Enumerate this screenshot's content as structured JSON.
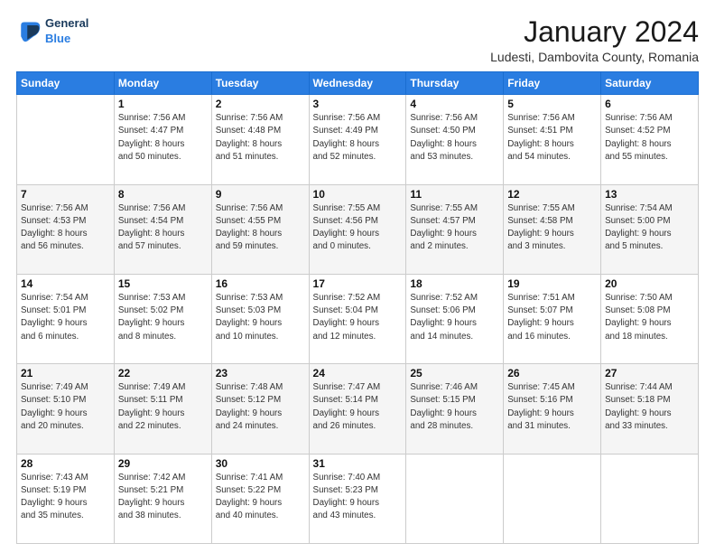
{
  "header": {
    "logo_line1": "General",
    "logo_line2": "Blue",
    "main_title": "January 2024",
    "subtitle": "Ludesti, Dambovita County, Romania"
  },
  "weekdays": [
    "Sunday",
    "Monday",
    "Tuesday",
    "Wednesday",
    "Thursday",
    "Friday",
    "Saturday"
  ],
  "weeks": [
    [
      {
        "day": "",
        "info": ""
      },
      {
        "day": "1",
        "info": "Sunrise: 7:56 AM\nSunset: 4:47 PM\nDaylight: 8 hours\nand 50 minutes."
      },
      {
        "day": "2",
        "info": "Sunrise: 7:56 AM\nSunset: 4:48 PM\nDaylight: 8 hours\nand 51 minutes."
      },
      {
        "day": "3",
        "info": "Sunrise: 7:56 AM\nSunset: 4:49 PM\nDaylight: 8 hours\nand 52 minutes."
      },
      {
        "day": "4",
        "info": "Sunrise: 7:56 AM\nSunset: 4:50 PM\nDaylight: 8 hours\nand 53 minutes."
      },
      {
        "day": "5",
        "info": "Sunrise: 7:56 AM\nSunset: 4:51 PM\nDaylight: 8 hours\nand 54 minutes."
      },
      {
        "day": "6",
        "info": "Sunrise: 7:56 AM\nSunset: 4:52 PM\nDaylight: 8 hours\nand 55 minutes."
      }
    ],
    [
      {
        "day": "7",
        "info": "Sunrise: 7:56 AM\nSunset: 4:53 PM\nDaylight: 8 hours\nand 56 minutes."
      },
      {
        "day": "8",
        "info": "Sunrise: 7:56 AM\nSunset: 4:54 PM\nDaylight: 8 hours\nand 57 minutes."
      },
      {
        "day": "9",
        "info": "Sunrise: 7:56 AM\nSunset: 4:55 PM\nDaylight: 8 hours\nand 59 minutes."
      },
      {
        "day": "10",
        "info": "Sunrise: 7:55 AM\nSunset: 4:56 PM\nDaylight: 9 hours\nand 0 minutes."
      },
      {
        "day": "11",
        "info": "Sunrise: 7:55 AM\nSunset: 4:57 PM\nDaylight: 9 hours\nand 2 minutes."
      },
      {
        "day": "12",
        "info": "Sunrise: 7:55 AM\nSunset: 4:58 PM\nDaylight: 9 hours\nand 3 minutes."
      },
      {
        "day": "13",
        "info": "Sunrise: 7:54 AM\nSunset: 5:00 PM\nDaylight: 9 hours\nand 5 minutes."
      }
    ],
    [
      {
        "day": "14",
        "info": "Sunrise: 7:54 AM\nSunset: 5:01 PM\nDaylight: 9 hours\nand 6 minutes."
      },
      {
        "day": "15",
        "info": "Sunrise: 7:53 AM\nSunset: 5:02 PM\nDaylight: 9 hours\nand 8 minutes."
      },
      {
        "day": "16",
        "info": "Sunrise: 7:53 AM\nSunset: 5:03 PM\nDaylight: 9 hours\nand 10 minutes."
      },
      {
        "day": "17",
        "info": "Sunrise: 7:52 AM\nSunset: 5:04 PM\nDaylight: 9 hours\nand 12 minutes."
      },
      {
        "day": "18",
        "info": "Sunrise: 7:52 AM\nSunset: 5:06 PM\nDaylight: 9 hours\nand 14 minutes."
      },
      {
        "day": "19",
        "info": "Sunrise: 7:51 AM\nSunset: 5:07 PM\nDaylight: 9 hours\nand 16 minutes."
      },
      {
        "day": "20",
        "info": "Sunrise: 7:50 AM\nSunset: 5:08 PM\nDaylight: 9 hours\nand 18 minutes."
      }
    ],
    [
      {
        "day": "21",
        "info": "Sunrise: 7:49 AM\nSunset: 5:10 PM\nDaylight: 9 hours\nand 20 minutes."
      },
      {
        "day": "22",
        "info": "Sunrise: 7:49 AM\nSunset: 5:11 PM\nDaylight: 9 hours\nand 22 minutes."
      },
      {
        "day": "23",
        "info": "Sunrise: 7:48 AM\nSunset: 5:12 PM\nDaylight: 9 hours\nand 24 minutes."
      },
      {
        "day": "24",
        "info": "Sunrise: 7:47 AM\nSunset: 5:14 PM\nDaylight: 9 hours\nand 26 minutes."
      },
      {
        "day": "25",
        "info": "Sunrise: 7:46 AM\nSunset: 5:15 PM\nDaylight: 9 hours\nand 28 minutes."
      },
      {
        "day": "26",
        "info": "Sunrise: 7:45 AM\nSunset: 5:16 PM\nDaylight: 9 hours\nand 31 minutes."
      },
      {
        "day": "27",
        "info": "Sunrise: 7:44 AM\nSunset: 5:18 PM\nDaylight: 9 hours\nand 33 minutes."
      }
    ],
    [
      {
        "day": "28",
        "info": "Sunrise: 7:43 AM\nSunset: 5:19 PM\nDaylight: 9 hours\nand 35 minutes."
      },
      {
        "day": "29",
        "info": "Sunrise: 7:42 AM\nSunset: 5:21 PM\nDaylight: 9 hours\nand 38 minutes."
      },
      {
        "day": "30",
        "info": "Sunrise: 7:41 AM\nSunset: 5:22 PM\nDaylight: 9 hours\nand 40 minutes."
      },
      {
        "day": "31",
        "info": "Sunrise: 7:40 AM\nSunset: 5:23 PM\nDaylight: 9 hours\nand 43 minutes."
      },
      {
        "day": "",
        "info": ""
      },
      {
        "day": "",
        "info": ""
      },
      {
        "day": "",
        "info": ""
      }
    ]
  ]
}
